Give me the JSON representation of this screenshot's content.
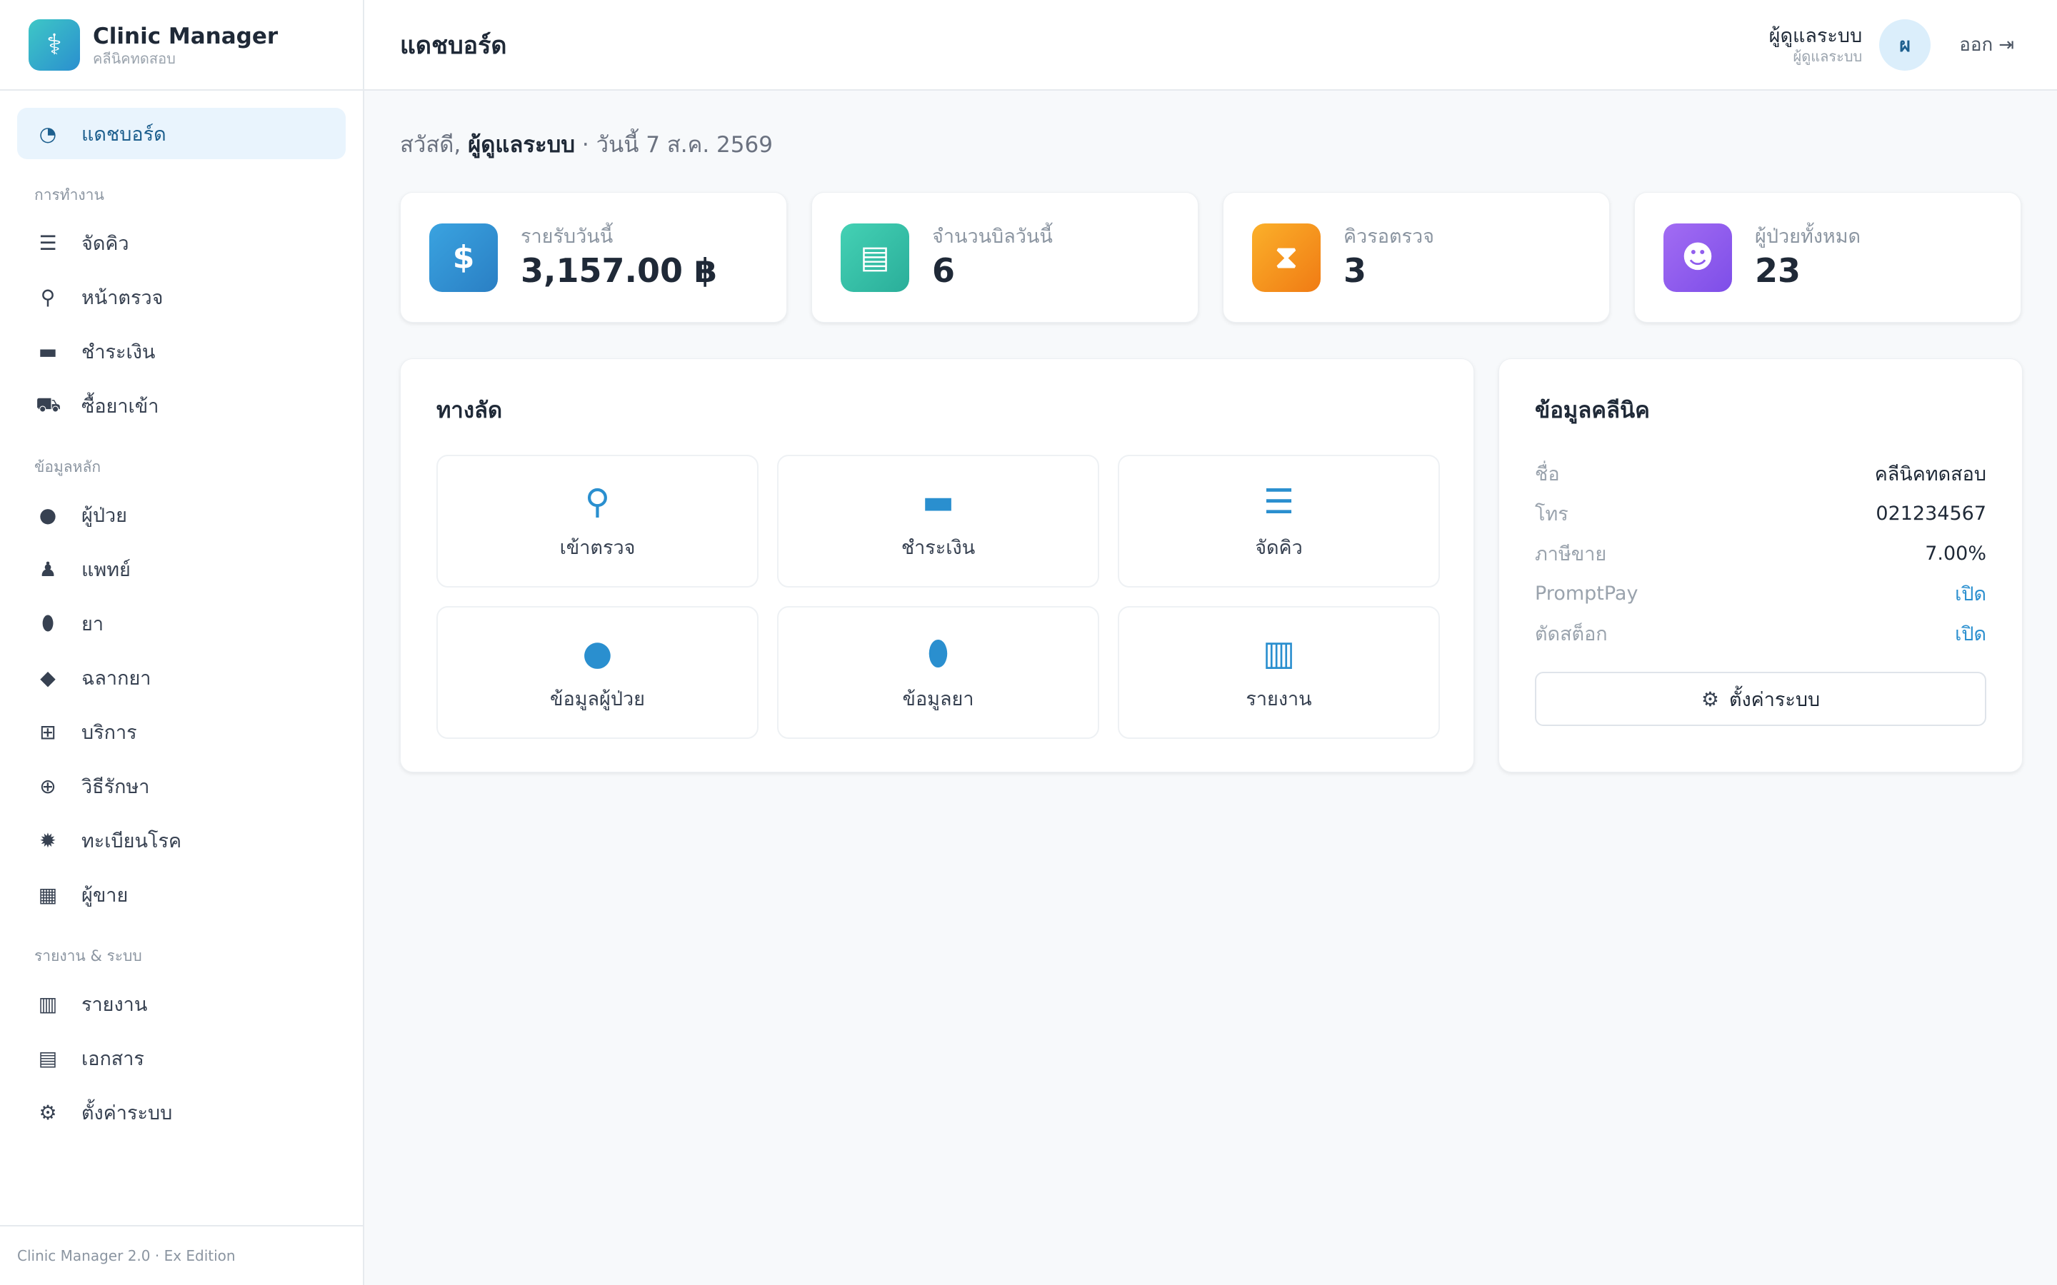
{
  "brand": {
    "title": "Clinic Manager",
    "subtitle": "คลีนิคทดสอบ",
    "logo_icon": "caduceus-icon"
  },
  "header": {
    "title": "แดชบอร์ด",
    "user_name": "ผู้ดูแลระบบ",
    "user_role": "ผู้ดูแลระบบ",
    "avatar_initial": "ผ",
    "logout_label": "ออก"
  },
  "sidebar": {
    "dashboard": {
      "label": "แดชบอร์ด",
      "icon": "gauge-icon"
    },
    "sections": {
      "work": "การทำงาน",
      "master": "ข้อมูลหลัก",
      "reports": "รายงาน & ระบบ"
    },
    "work_items": [
      {
        "label": "จัดคิว",
        "icon": "list-ol-icon"
      },
      {
        "label": "หน้าตรวจ",
        "icon": "stethoscope-icon"
      },
      {
        "label": "ชำระเงิน",
        "icon": "credit-card-icon"
      },
      {
        "label": "ซื้อยาเข้า",
        "icon": "truck-medical-icon"
      }
    ],
    "master_items": [
      {
        "label": "ผู้ป่วย",
        "icon": "user-icon"
      },
      {
        "label": "แพทย์",
        "icon": "user-doctor-icon"
      },
      {
        "label": "ยา",
        "icon": "pills-icon"
      },
      {
        "label": "ฉลากยา",
        "icon": "tag-icon"
      },
      {
        "label": "บริการ",
        "icon": "medkit-icon"
      },
      {
        "label": "วิธีรักษา",
        "icon": "notes-medical-icon"
      },
      {
        "label": "ทะเบียนโรค",
        "icon": "virus-icon"
      },
      {
        "label": "ผู้ขาย",
        "icon": "building-icon"
      }
    ],
    "report_items": [
      {
        "label": "รายงาน",
        "icon": "chart-bar-icon"
      },
      {
        "label": "เอกสาร",
        "icon": "file-icon"
      },
      {
        "label": "ตั้งค่าระบบ",
        "icon": "gear-icon"
      }
    ],
    "footer": "Clinic Manager 2.0 · Ex Edition"
  },
  "greeting": {
    "prefix": "สวัสดี,",
    "name": "ผู้ดูแลระบบ",
    "suffix": "· วันนี้ 7 ส.ค. 2569"
  },
  "stats": [
    {
      "label": "รายรับวันนี้",
      "value": "3,157.00 ฿",
      "icon": "money-bag-icon",
      "color_from": "#3aa3e0",
      "color_to": "#2a7fc4"
    },
    {
      "label": "จำนวนบิลวันนี้",
      "value": "6",
      "icon": "receipt-icon",
      "color_from": "#44d1b4",
      "color_to": "#2aae9a"
    },
    {
      "label": "คิวรอตรวจ",
      "value": "3",
      "icon": "hourglass-icon",
      "color_from": "#fbb02a",
      "color_to": "#f07b14"
    },
    {
      "label": "ผู้ป่วยทั้งหมด",
      "value": "23",
      "icon": "users-icon",
      "color_from": "#a26cf3",
      "color_to": "#7e4ee8"
    }
  ],
  "shortcuts": {
    "title": "ทางลัด",
    "items": [
      {
        "label": "เข้าตรวจ",
        "icon": "stethoscope-icon"
      },
      {
        "label": "ชำระเงิน",
        "icon": "credit-card-icon"
      },
      {
        "label": "จัดคิว",
        "icon": "list-ol-icon"
      },
      {
        "label": "ข้อมูลผู้ป่วย",
        "icon": "user-icon"
      },
      {
        "label": "ข้อมูลยา",
        "icon": "pills-icon"
      },
      {
        "label": "รายงาน",
        "icon": "chart-bar-icon"
      }
    ]
  },
  "clinic": {
    "title": "ข้อมูลคลีนิค",
    "rows": [
      {
        "k": "ชื่อ",
        "v": "คลีนิคทดสอบ"
      },
      {
        "k": "โทร",
        "v": "021234567"
      },
      {
        "k": "ภาษีขาย",
        "v": "7.00%"
      },
      {
        "k": "PromptPay",
        "v": "เปิด"
      },
      {
        "k": "ตัดสต็อก",
        "v": "เปิด"
      }
    ],
    "settings_label": "ตั้งค่าระบบ"
  },
  "colors": {
    "accent": "#2a8fcf",
    "active_bg": "#e9f4fd"
  }
}
